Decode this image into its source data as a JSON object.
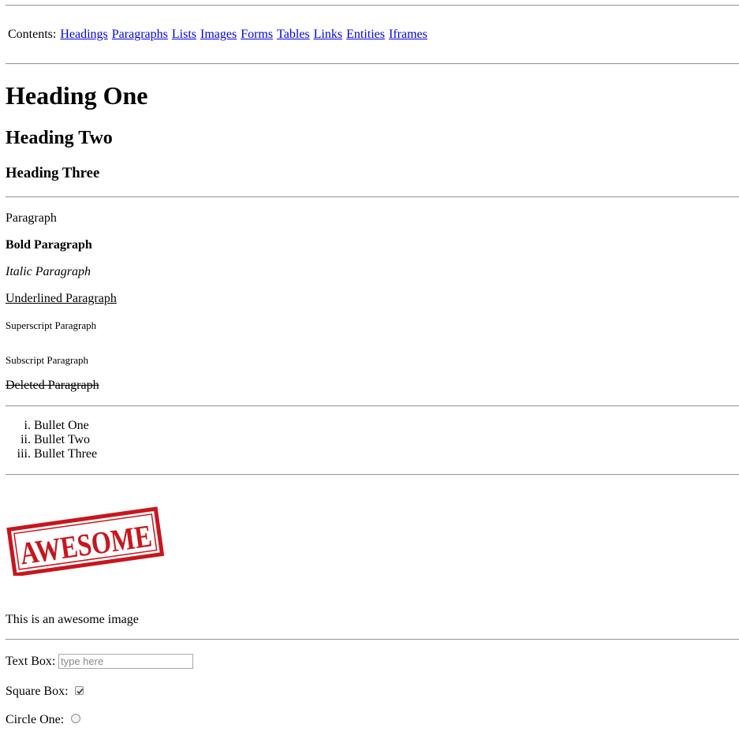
{
  "contents": {
    "label": "Contents:",
    "links": [
      "Headings",
      "Paragraphs",
      "Lists",
      "Images",
      "Forms",
      "Tables",
      "Links",
      "Entities",
      "Iframes"
    ]
  },
  "headings": {
    "h1": "Heading One",
    "h2": "Heading Two",
    "h3": "Heading Three"
  },
  "paragraphs": {
    "plain": "Paragraph",
    "bold": "Bold Paragraph",
    "italic": "Italic Paragraph",
    "underlined": "Underlined Paragraph",
    "superscript": "Superscript Paragraph",
    "subscript": "Subscript Paragraph",
    "deleted": "Deleted Paragraph"
  },
  "list": {
    "items": [
      {
        "marker": "i.",
        "text": "Bullet One"
      },
      {
        "marker": "ii.",
        "text": "Bullet Two"
      },
      {
        "marker": "iii.",
        "text": "Bullet Three"
      }
    ]
  },
  "image": {
    "stamp_text": "AWESOME",
    "stamp_color": "#c8161d",
    "caption": "This is an awesome image"
  },
  "form": {
    "textbox_label": "Text Box:",
    "textbox_placeholder": "type here",
    "checkbox_label": "Square Box:",
    "checkbox_checked": true,
    "radio_label": "Circle One:",
    "radio_checked": false
  }
}
